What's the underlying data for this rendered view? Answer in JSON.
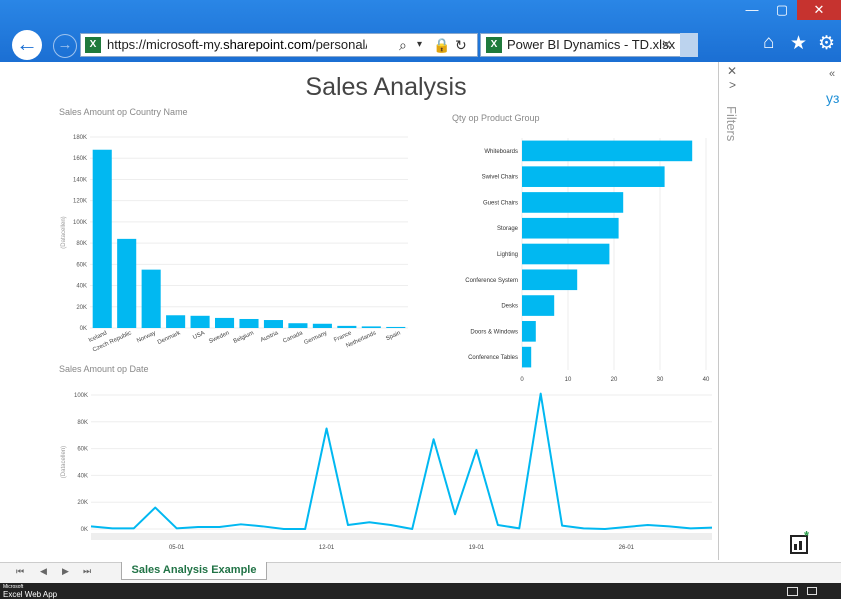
{
  "window": {
    "minimize_icon": "minimize-icon",
    "maximize_icon": "maximize-icon",
    "close_icon": "close-icon",
    "minimize_glyph": "—",
    "maximize_glyph": "▢",
    "close_glyph": "✕"
  },
  "browser": {
    "back_glyph": "←",
    "forward_glyph": "→",
    "address": {
      "prefix": "https://microsoft-my.",
      "domain": "sharepoint.com",
      "suffix": "/personal/kurtju_m",
      "icon_label": "X"
    },
    "tab": {
      "title": "Power BI Dynamics - TD.xlsx",
      "close_glyph": "✕",
      "icon_label": "X"
    },
    "tools": {
      "home": "⌂",
      "favorites": "★",
      "settings": "⚙"
    }
  },
  "report": {
    "title": "Sales Analysis"
  },
  "filters_pane": {
    "close_glyph": "✕",
    "expand_glyph": ">",
    "label": "Filters"
  },
  "right_pane": {
    "collapse_glyph": "«",
    "link_text": "уз"
  },
  "sheet_bar": {
    "nav": [
      "⏮",
      "◀",
      "▶",
      "⏭"
    ],
    "active_sheet": "Sales Analysis Example"
  },
  "status_bar": {
    "brand_small": "Microsoft",
    "brand": "Excel Web App"
  },
  "colors": {
    "bar": "#01b8f1",
    "line": "#01b8f1",
    "accent": "#1b6fd3"
  },
  "chart_data": [
    {
      "type": "bar",
      "title": "Sales Amount op Country Name",
      "ylabel": "(Datacellen)",
      "categories": [
        "Iceland",
        "Czech Republic",
        "Norway",
        "Denmark",
        "USA",
        "Sweden",
        "Belgium",
        "Austria",
        "Canada",
        "Germany",
        "France",
        "Netherlands",
        "Spain"
      ],
      "values": [
        168000,
        84000,
        55000,
        12000,
        11500,
        9500,
        8500,
        7500,
        4500,
        4000,
        2000,
        1500,
        1000
      ],
      "ylim": [
        0,
        180000
      ],
      "yticks": [
        "0K",
        "20K",
        "40K",
        "60K",
        "80K",
        "100K",
        "120K",
        "140K",
        "160K",
        "180K"
      ],
      "grid": true
    },
    {
      "type": "bar",
      "orientation": "horizontal",
      "title": "Qty op Product Group",
      "categories": [
        "Whiteboards",
        "Swivel Chairs",
        "Guest Chairs",
        "Storage",
        "Lighting",
        "Conference System",
        "Desks",
        "Doors & Windows",
        "Conference Tables"
      ],
      "values": [
        37,
        31,
        22,
        21,
        19,
        12,
        7,
        3,
        2
      ],
      "xlim": [
        0,
        40
      ],
      "xticks": [
        "0",
        "10",
        "20",
        "30",
        "40"
      ],
      "grid": true
    },
    {
      "type": "line",
      "title": "Sales Amount op Date",
      "ylabel": "(Datacellen)",
      "xticks": [
        "05-01",
        "12-01",
        "19-01",
        "26-01"
      ],
      "x": [
        "01-01",
        "02-01",
        "03-01",
        "04-01",
        "05-01",
        "06-01",
        "07-01",
        "08-01",
        "09-01",
        "10-01",
        "11-01",
        "12-01",
        "13-01",
        "14-01",
        "15-01",
        "16-01",
        "17-01",
        "18-01",
        "19-01",
        "20-01",
        "21-01",
        "22-01",
        "23-01",
        "24-01",
        "25-01",
        "26-01",
        "27-01",
        "28-01",
        "29-01",
        "30-01"
      ],
      "values": [
        2000,
        500,
        500,
        16000,
        500,
        1500,
        1500,
        3500,
        2000,
        0,
        0,
        75000,
        3000,
        5000,
        3000,
        0,
        67000,
        11000,
        59000,
        3000,
        500,
        101000,
        2500,
        500,
        0,
        1500,
        3000,
        2000,
        500,
        1000
      ],
      "ylim": [
        0,
        100000
      ],
      "yticks": [
        "0K",
        "20K",
        "40K",
        "60K",
        "80K",
        "100K"
      ],
      "grid": true
    }
  ]
}
